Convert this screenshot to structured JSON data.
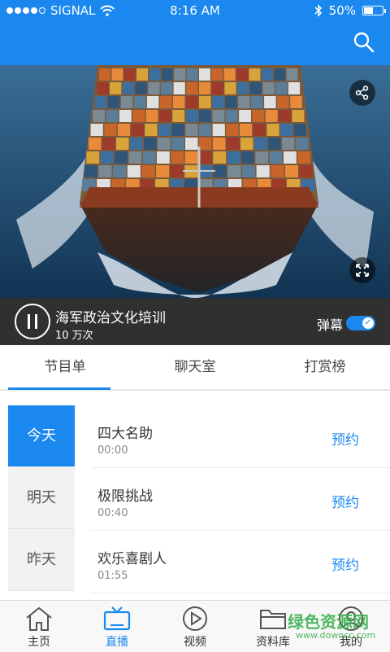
{
  "status_bar": {
    "carrier": "SIGNAL",
    "time": "8:16 AM",
    "battery": "50%",
    "battery_level": 0.5
  },
  "header": {
    "search_icon": "search-icon"
  },
  "video": {
    "title": "海军政治文化培训",
    "views": "10 万次",
    "danmu_label": "弹幕",
    "danmu_enabled": true,
    "icons": [
      "share-icon",
      "fullscreen-icon",
      "pause-icon"
    ]
  },
  "tabs": [
    {
      "label": "节目单",
      "active": true
    },
    {
      "label": "聊天室",
      "active": false
    },
    {
      "label": "打赏榜",
      "active": false
    }
  ],
  "days": [
    {
      "label": "今天",
      "active": true
    },
    {
      "label": "明天",
      "active": false
    },
    {
      "label": "昨天",
      "active": false
    }
  ],
  "programs": [
    {
      "name": "四大名助",
      "time": "00:00",
      "action": "预约"
    },
    {
      "name": "极限挑战",
      "time": "00:40",
      "action": "预约"
    },
    {
      "name": "欢乐喜剧人",
      "time": "01:55",
      "action": "预约"
    }
  ],
  "bottom_nav": [
    {
      "label": "主页",
      "icon": "home-icon",
      "active": false
    },
    {
      "label": "直播",
      "icon": "tv-icon",
      "active": true
    },
    {
      "label": "视频",
      "icon": "play-icon",
      "active": false
    },
    {
      "label": "资料库",
      "icon": "folder-icon",
      "active": false
    },
    {
      "label": "我的",
      "icon": "user-icon",
      "active": false
    }
  ],
  "watermark": {
    "line1": "绿色资源网",
    "line2": "www.downcc.com"
  },
  "colors": {
    "primary": "#1a88ee",
    "info_bar": "#303030"
  }
}
